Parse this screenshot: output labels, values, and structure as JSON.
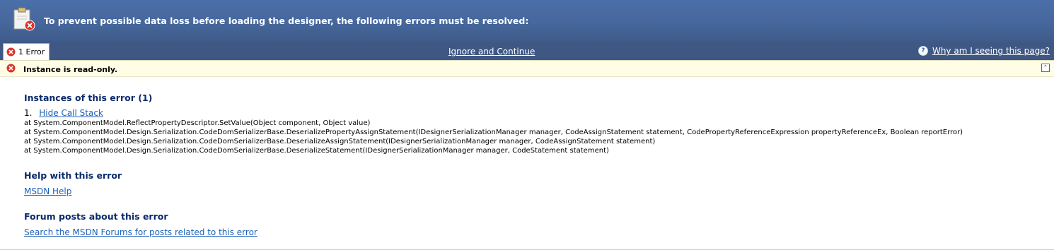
{
  "header": {
    "message": "To prevent possible data loss before loading the designer, the following errors must be resolved:",
    "background": "#46679c",
    "icon": "clipboard-error-icon"
  },
  "tabbar": {
    "error_tab_label": "1 Error",
    "ignore_label": "Ignore and Continue",
    "why_label": "Why am I seeing this page?",
    "help_icon_glyph": "?"
  },
  "error_bar": {
    "message": "Instance is read-only.",
    "collapse_glyph": "⌃"
  },
  "instances": {
    "title": "Instances of this error (1)",
    "item_number": "1.",
    "hide_call_stack_label": "Hide Call Stack",
    "stack": [
      "at System.ComponentModel.ReflectPropertyDescriptor.SetValue(Object component, Object value)",
      "at System.ComponentModel.Design.Serialization.CodeDomSerializerBase.DeserializePropertyAssignStatement(IDesignerSerializationManager manager, CodeAssignStatement statement, CodePropertyReferenceExpression propertyReferenceEx, Boolean reportError)",
      "at System.ComponentModel.Design.Serialization.CodeDomSerializerBase.DeserializeAssignStatement(IDesignerSerializationManager manager, CodeAssignStatement statement)",
      "at System.ComponentModel.Design.Serialization.CodeDomSerializerBase.DeserializeStatement(IDesignerSerializationManager manager, CodeStatement statement)"
    ]
  },
  "help": {
    "title": "Help with this error",
    "msdn_label": "MSDN Help"
  },
  "forum": {
    "title": "Forum posts about this error",
    "search_label": "Search the MSDN Forums for posts related to this error"
  },
  "colors": {
    "header": "#46679c",
    "tabbar": "#3f5783",
    "error_bar": "#fffde5",
    "section_title": "#0b2a6b",
    "link": "#1d61b7",
    "error_red": "#d9342b"
  }
}
